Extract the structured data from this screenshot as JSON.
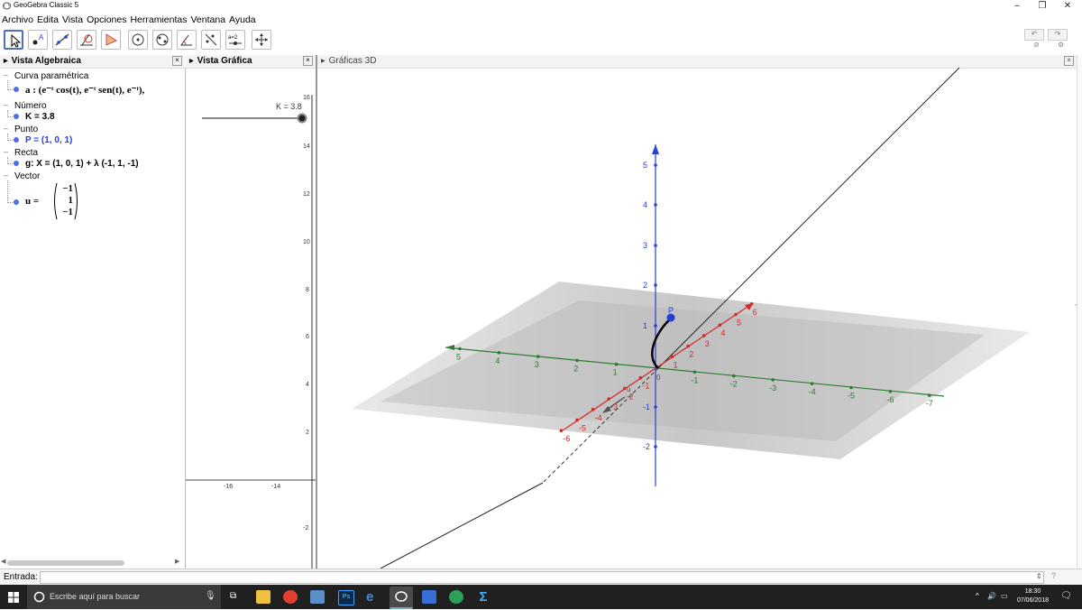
{
  "window": {
    "title": "GeoGebra Classic 5",
    "controls": [
      "–",
      "❐",
      "✕"
    ]
  },
  "menu": [
    "Archivo",
    "Edita",
    "Vista",
    "Opciones",
    "Herramientas",
    "Ventana",
    "Ayuda"
  ],
  "toolbar": {
    "tools": [
      "move-tool",
      "point-tool",
      "line-tool",
      "perpendicular-tool",
      "polygon-tool",
      "circle-tool",
      "ellipse-tool",
      "angle-tool",
      "reflect-tool",
      "slider-tool",
      "move-view-tool"
    ],
    "slider_tool_label": "a=2",
    "undo": "↶",
    "redo": "↷"
  },
  "panels": {
    "algebra_title": "Vista Algebraica",
    "graphics_title": "Vista Gráfica",
    "graphics3d_title": "Gráficas 3D"
  },
  "algebra": {
    "cat_curve": "Curva paramétrica",
    "curve_name": "a :",
    "curve_body": "(e⁻ᵗ cos(t), e⁻ᵗ sen(t), e⁻ᵗ),",
    "cat_number": "Número",
    "number": "K = 3.8",
    "cat_point": "Punto",
    "point": "P = (1, 0, 1)",
    "cat_line": "Recta",
    "line": "g: X = (1, 0, 1) + λ (-1, 1, -1)",
    "cat_vector": "Vector",
    "vector_name": "u =",
    "vector_values": [
      "−1",
      "1",
      "−1"
    ]
  },
  "graphics2d": {
    "slider_label": "K = 3.8",
    "slider_value": 3.8,
    "y_ticks": [
      "16",
      "14",
      "12",
      "10",
      "8",
      "6",
      "4",
      "2",
      "-2"
    ],
    "x_ticks": [
      "-16",
      "-14"
    ]
  },
  "graphics3d": {
    "point_label": "P",
    "z_ticks": [
      "5",
      "4",
      "3",
      "2",
      "1",
      "-1",
      "-2"
    ],
    "x_pos_ticks": [
      "1",
      "2",
      "3",
      "4",
      "5",
      "6"
    ],
    "x_neg_ticks": [
      "-1",
      "-2",
      "-3",
      "-4",
      "-5",
      "-6"
    ],
    "y_pos_ticks": [
      "1",
      "2",
      "3",
      "4",
      "5"
    ],
    "y_neg_ticks": [
      "-1",
      "-2",
      "-3",
      "-4",
      "-5",
      "-6",
      "-7"
    ],
    "origin_label": "0",
    "vector_label": "u",
    "colors": {
      "x_axis": "#d42a2a",
      "y_axis": "#2e7d32",
      "z_axis": "#2a3fd4",
      "point": "#1f3fd6"
    }
  },
  "input_bar": {
    "label": "Entrada:"
  },
  "taskbar": {
    "search_placeholder": "Escribe aquí para buscar",
    "time": "18:30",
    "date": "07/06/2018"
  }
}
